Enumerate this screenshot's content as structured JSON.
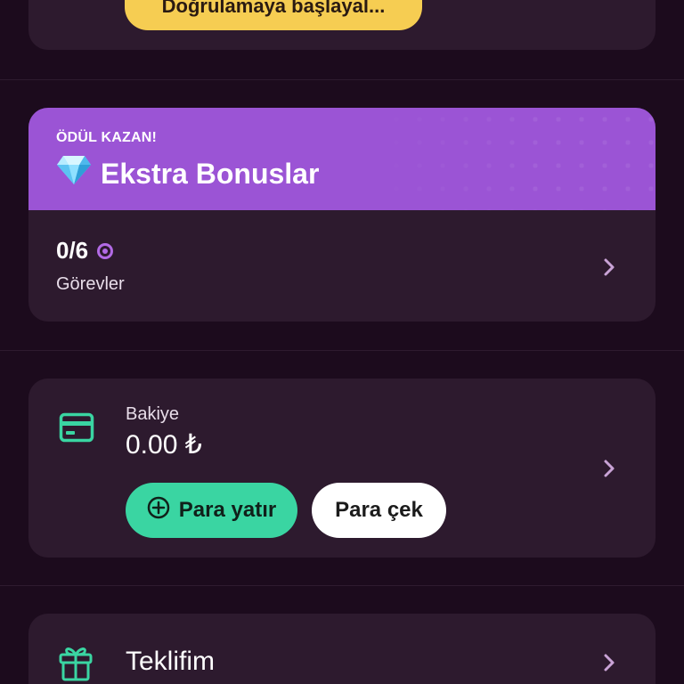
{
  "verification": {
    "button_label": "Doğrulamaya başlayal..."
  },
  "bonus": {
    "kicker": "ÖDÜL KAZAN!",
    "title": "Ekstra Bonuslar",
    "title_icon": "gem-icon",
    "progress": "0/6",
    "progress_label": "Görevler",
    "header_color": "#9b54d5"
  },
  "balance": {
    "label": "Bakiye",
    "value": "0.00 ₺",
    "deposit_label": "Para yatır",
    "withdraw_label": "Para çek",
    "deposit_color": "#3ad5a2"
  },
  "offer": {
    "label": "Teklifim"
  },
  "colors": {
    "background": "#1c0b1d",
    "card": "#2d1a2e",
    "accent_green": "#3ad5a2",
    "accent_yellow": "#f6cd52",
    "accent_purple": "#9b54d5"
  }
}
